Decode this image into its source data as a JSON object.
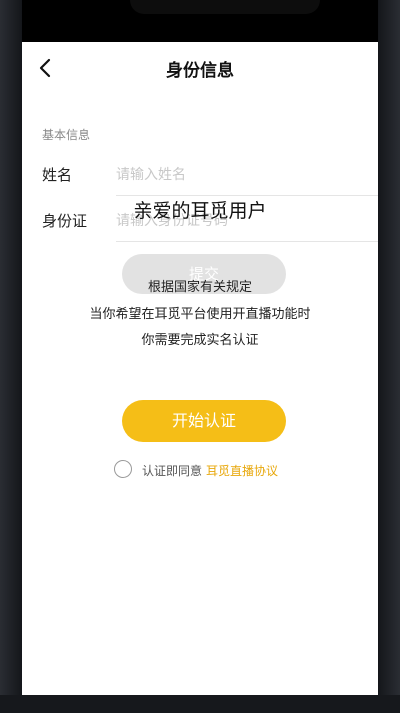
{
  "nav": {
    "title": "身份信息"
  },
  "form": {
    "section_label": "基本信息",
    "name_label": "姓名",
    "name_placeholder": "请输入姓名",
    "id_label": "身份证",
    "id_placeholder": "请输入身份证号码",
    "submit_label": "提交"
  },
  "notice": {
    "title": "亲爱的耳觅用户",
    "lines": [
      "根据国家有关规定",
      "当你希望在耳觅平台使用开直播功能时",
      "你需要完成实名认证"
    ]
  },
  "start_button": "开始认证",
  "agreement": {
    "text": "认证即同意",
    "link": "耳觅直播协议"
  },
  "colors": {
    "accent": "#f5be17",
    "link": "#e8a80c"
  }
}
